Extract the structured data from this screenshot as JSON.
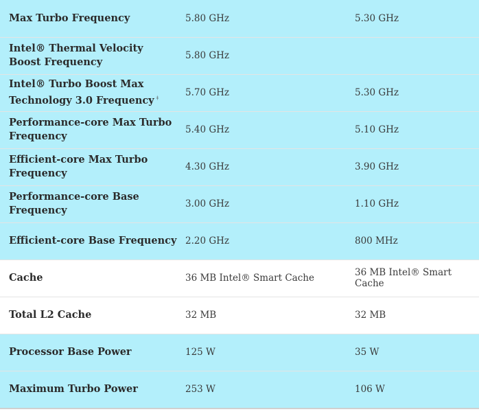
{
  "rows": [
    {
      "label": "Max Turbo Frequency",
      "footnote": "",
      "value_1": "5.80 GHz",
      "value_2": "5.30 GHz",
      "style": "highlight"
    },
    {
      "label": "Intel® Thermal Velocity Boost Frequency",
      "footnote": "",
      "value_1": "5.80 GHz",
      "value_2": "",
      "style": "highlight"
    },
    {
      "label": "Intel® Turbo Boost Max Technology 3.0 Frequency",
      "footnote": "‡",
      "value_1": "5.70 GHz",
      "value_2": "5.30 GHz",
      "style": "highlight"
    },
    {
      "label": "Performance-core Max Turbo Frequency",
      "footnote": "",
      "value_1": "5.40 GHz",
      "value_2": "5.10 GHz",
      "style": "highlight"
    },
    {
      "label": "Efficient-core Max Turbo Frequency",
      "footnote": "",
      "value_1": "4.30 GHz",
      "value_2": "3.90 GHz",
      "style": "highlight"
    },
    {
      "label": "Performance-core Base Frequency",
      "footnote": "",
      "value_1": "3.00 GHz",
      "value_2": "1.10 GHz",
      "style": "highlight"
    },
    {
      "label": "Efficient-core Base Frequency",
      "footnote": "",
      "value_1": "2.20 GHz",
      "value_2": "800 MHz",
      "style": "highlight"
    },
    {
      "label": "Cache",
      "footnote": "",
      "value_1": "36 MB Intel® Smart Cache",
      "value_2": "36 MB Intel® Smart Cache",
      "style": "plain"
    },
    {
      "label": "Total L2 Cache",
      "footnote": "",
      "value_1": "32 MB",
      "value_2": "32 MB",
      "style": "plain"
    },
    {
      "label": "Processor Base Power",
      "footnote": "",
      "value_1": "125 W",
      "value_2": "35 W",
      "style": "highlight"
    },
    {
      "label": "Maximum Turbo Power",
      "footnote": "",
      "value_1": "253 W",
      "value_2": "106 W",
      "style": "highlight"
    }
  ],
  "colors": {
    "highlight_row": "#b3effb",
    "plain_row": "#ffffff",
    "row_divider": "#e4e4e4"
  }
}
